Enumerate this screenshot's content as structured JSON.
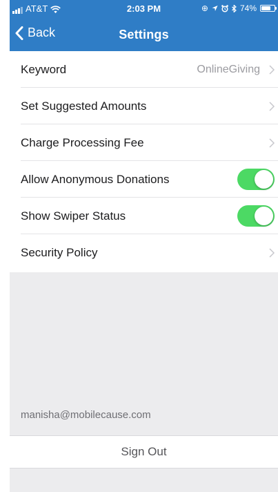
{
  "status_bar": {
    "carrier": "AT&T",
    "time": "2:03 PM",
    "battery_text": "74%",
    "battery_level": 0.74,
    "icons": [
      "signal-icon",
      "wifi-icon",
      "screen-lock-icon",
      "location-icon",
      "alarm-icon",
      "bluetooth-icon",
      "battery-icon"
    ]
  },
  "nav": {
    "back_label": "Back",
    "title": "Settings"
  },
  "settings": {
    "keyword": {
      "label": "Keyword",
      "value": "OnlineGiving"
    },
    "suggested_amounts": {
      "label": "Set Suggested Amounts"
    },
    "processing_fee": {
      "label": "Charge Processing Fee"
    },
    "anonymous_donations": {
      "label": "Allow Anonymous Donations",
      "enabled": true
    },
    "swiper_status": {
      "label": "Show Swiper Status",
      "enabled": true
    },
    "security_policy": {
      "label": "Security Policy"
    }
  },
  "account": {
    "email": "manisha@mobilecause.com",
    "sign_out_label": "Sign Out"
  },
  "colors": {
    "header_blue": "#2f7dc6",
    "toggle_on": "#4cd964",
    "background_gray": "#ececee"
  }
}
